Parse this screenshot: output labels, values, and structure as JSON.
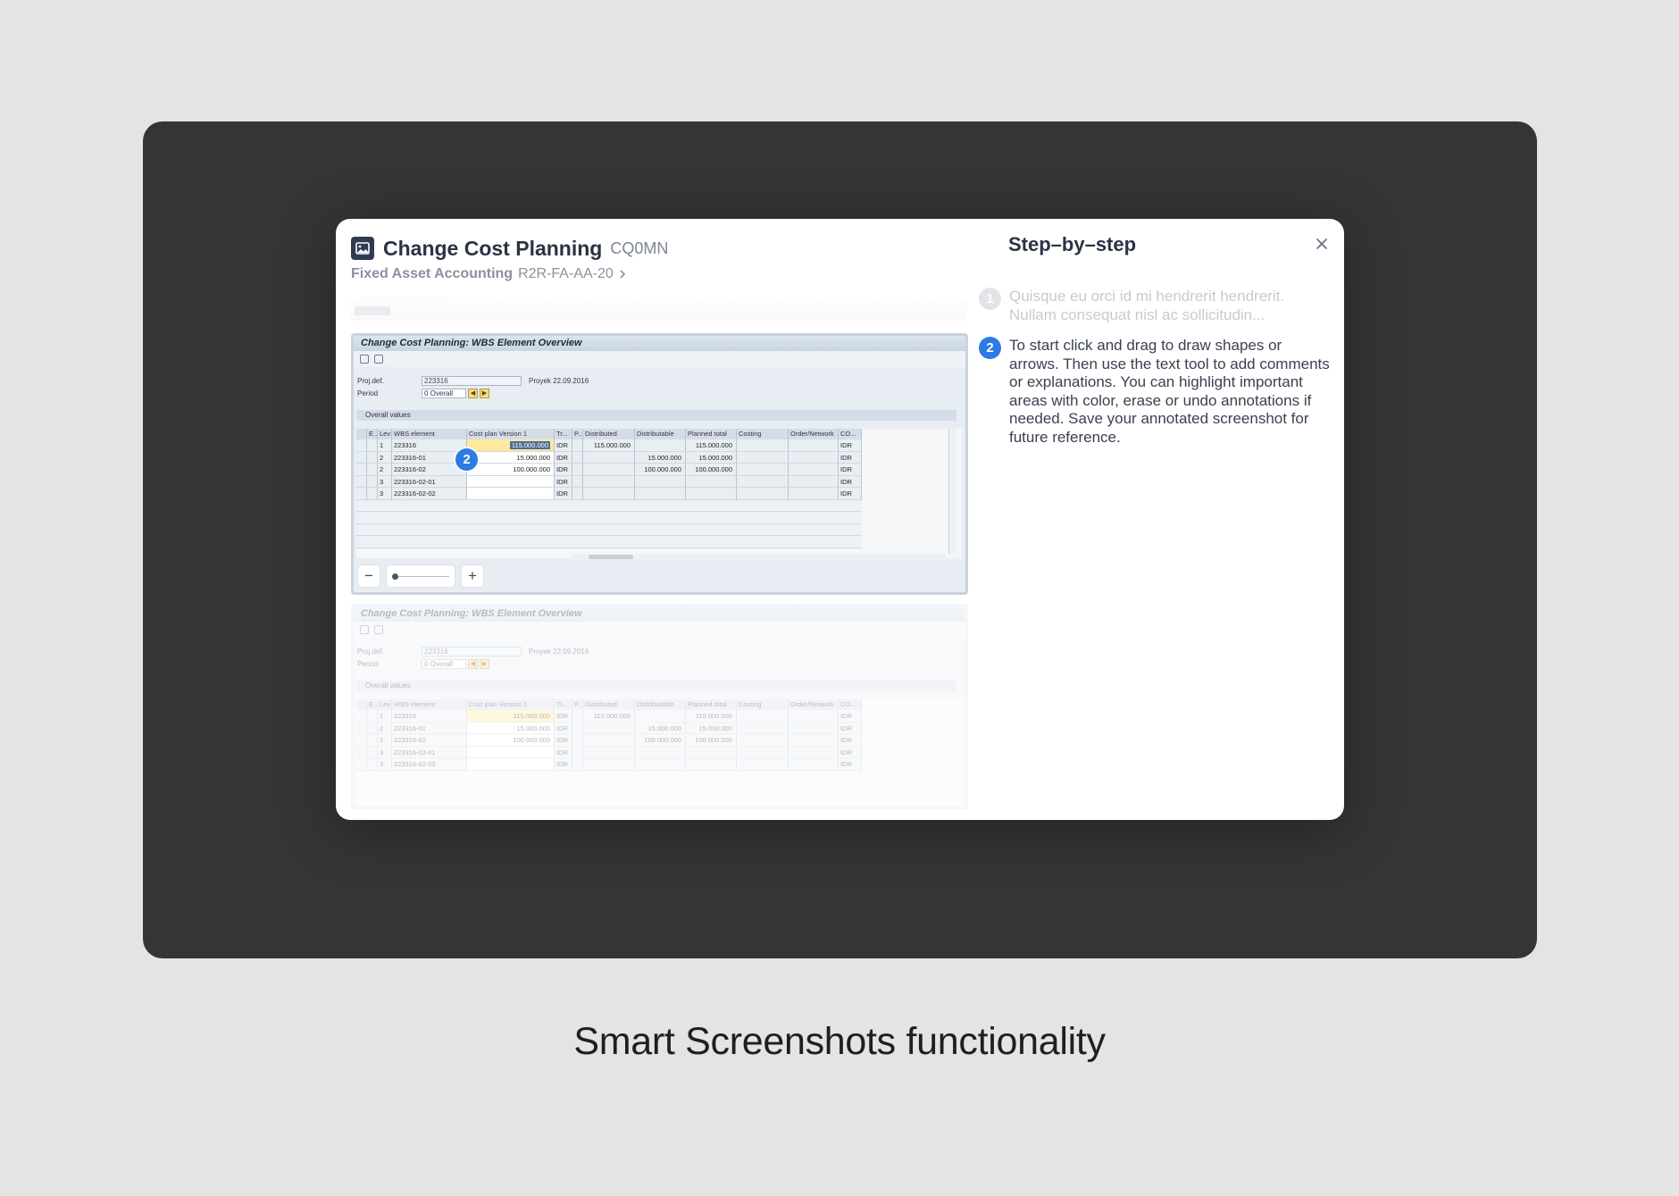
{
  "caption": "Smart Screenshots functionality",
  "modal": {
    "title": "Change Cost Planning",
    "tcode": "CQ0MN",
    "breadcrumb": {
      "label": "Fixed Asset Accounting",
      "code": "R2R-FA-AA-20"
    },
    "icons": {
      "app": "image-icon",
      "chevron": "chevron-right-icon",
      "close": "close-icon"
    }
  },
  "sap": {
    "window_title": "Change Cost Planning: WBS Element Overview",
    "fields": {
      "projdef_label": "Proj.def.",
      "projdef_value": "223316",
      "projdef_desc": "Proyek 22.09.2016",
      "period_label": "Period",
      "period_value": "0 Overall"
    },
    "overall_values_label": "Overall values",
    "columns": [
      "E..",
      "Lev",
      "WBS element",
      "Cost plan Version 1",
      "Tr...",
      "P...",
      "Distributed",
      "Distributable",
      "Planned total",
      "Costing",
      "Order/Network",
      "CO..."
    ],
    "rows": [
      {
        "lev": "1",
        "wbs": "223316",
        "cost": "115.000.000",
        "curr": "IDR",
        "distributed": "115.000.000",
        "distributable": "",
        "planned": "115.000.000"
      },
      {
        "lev": "2",
        "wbs": "223316-01",
        "cost": "15.000.000",
        "curr": "IDR",
        "distributed": "",
        "distributable": "15.000.000",
        "planned": "15.000.000"
      },
      {
        "lev": "2",
        "wbs": "223316-02",
        "cost": "100.000.000",
        "curr": "IDR",
        "distributed": "",
        "distributable": "100.000.000",
        "planned": "100.000.000"
      },
      {
        "lev": "3",
        "wbs": "223316-02-01",
        "cost": "",
        "curr": "IDR",
        "distributed": "",
        "distributable": "",
        "planned": ""
      },
      {
        "lev": "3",
        "wbs": "223316-02-02",
        "cost": "",
        "curr": "IDR",
        "distributed": "",
        "distributable": "",
        "planned": ""
      }
    ],
    "marker": "2"
  },
  "zoom": {
    "minus": "−",
    "plus": "+",
    "level": 0.05
  },
  "panel": {
    "title": "Step–by–step",
    "steps": [
      {
        "num": "1",
        "text": "Quisque eu orci id mi hendrerit hendrerit. Nullam consequat nisl ac sollicitudin..."
      },
      {
        "num": "2",
        "text": "To start click and drag to draw shapes or arrows. Then use the text tool to add comments or explanations. You can highlight important areas with color, erase or undo annotations if needed. Save your annotated screenshot for future reference."
      }
    ]
  },
  "colors": {
    "accent": "#2c7be5",
    "frame": "#343535",
    "background": "#e4e4e4"
  }
}
